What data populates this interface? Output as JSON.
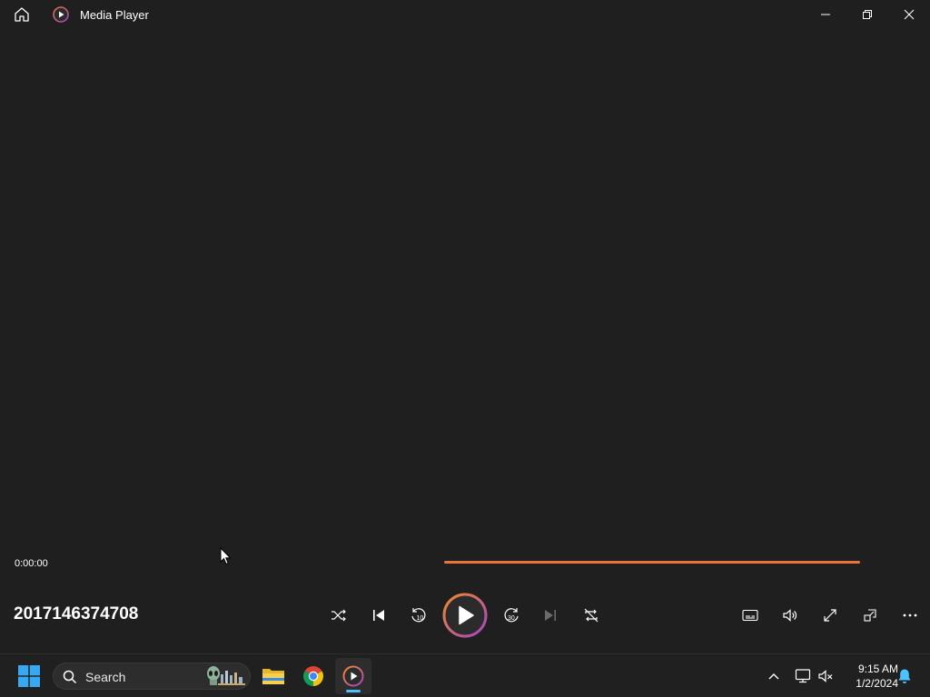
{
  "window": {
    "title": "Media Player",
    "icons": [
      "home-icon",
      "media-player-icon",
      "minimize-icon",
      "restore-icon",
      "close-icon"
    ]
  },
  "player": {
    "current_time": "0:00:00",
    "progress": 0,
    "media_title": "2017146374708",
    "controls": [
      "shuffle-icon",
      "previous-icon",
      "rewind-10-icon",
      "play-icon",
      "forward-30-icon",
      "next-icon",
      "repeat-off-icon",
      "captions-icon",
      "volume-icon",
      "fullscreen-icon",
      "miniplayer-icon",
      "more-options-icon"
    ]
  },
  "taskbar": {
    "search_placeholder": "Search",
    "time": "9:15 AM",
    "date": "1/2/2024"
  },
  "colors": {
    "background": "#1f1f1f",
    "accent_orange": "#e8743b",
    "accent_purple": "#a544c4",
    "taskbar": "#202020"
  }
}
